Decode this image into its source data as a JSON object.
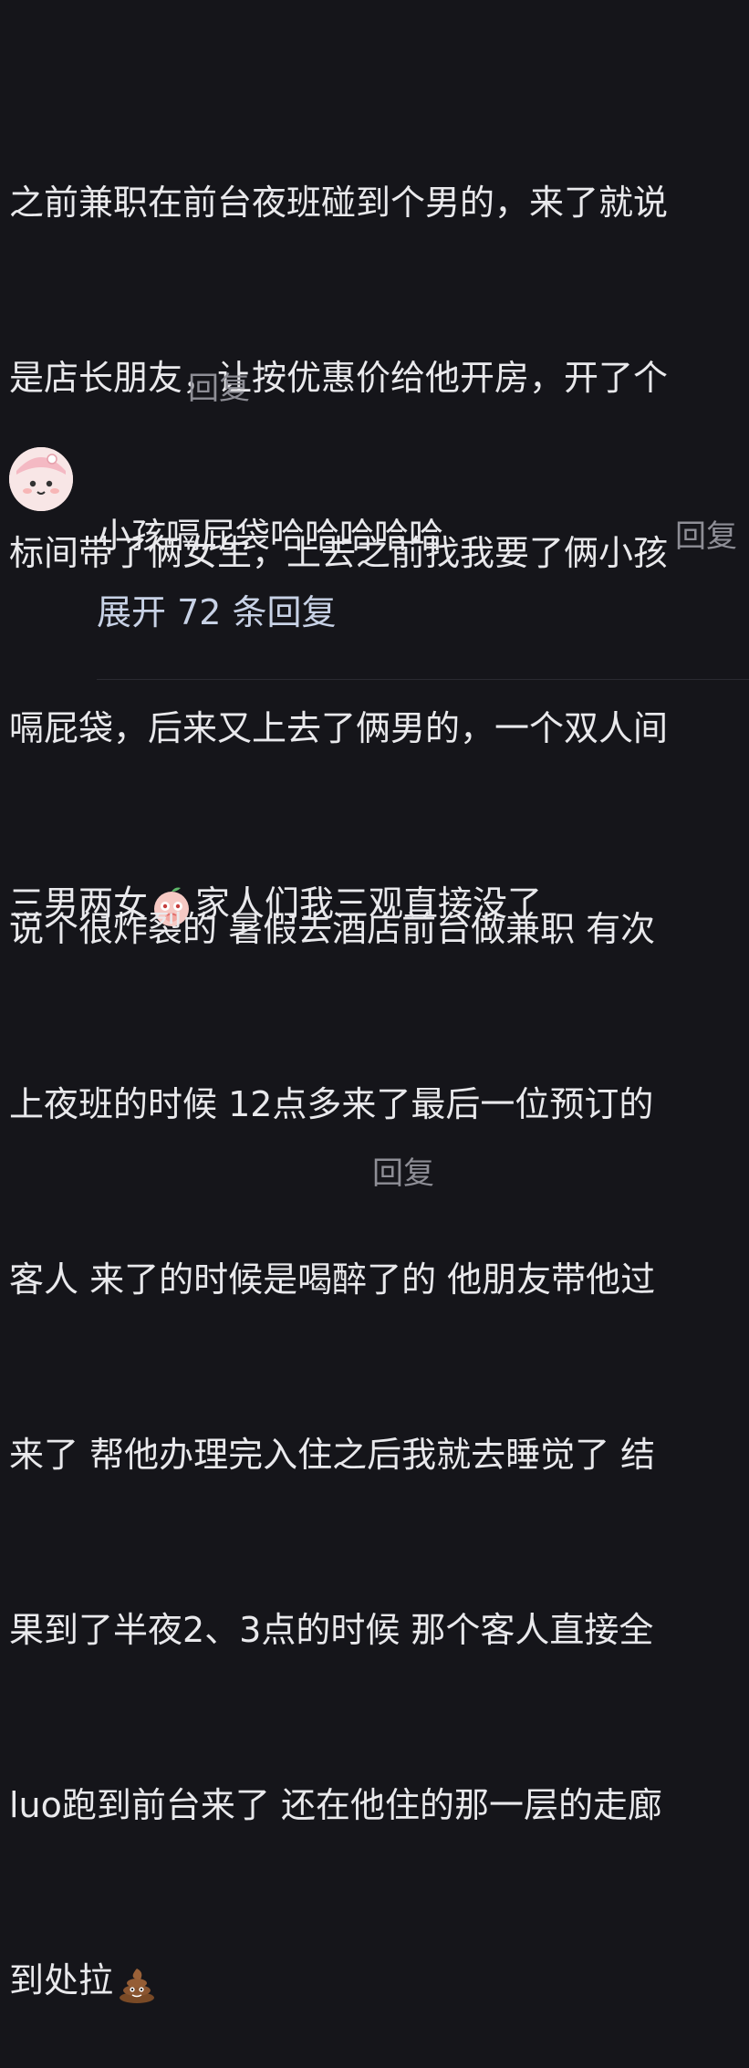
{
  "comments": [
    {
      "lines": [
        "之前兼职在前台夜班碰到个男的，来了就说",
        "是店长朋友，让按优惠价给他开房，开了个",
        "标间带了俩女生，上去之前找我要了俩小孩",
        "嗝屁袋，后来又上去了俩男的，一个双人间"
      ],
      "last_line_before_emoji": "三男两女",
      "emoji": "peach-shy-emoji",
      "last_line_after_emoji": "家人们我三观直接没了",
      "reply_label": "回复"
    },
    {
      "lines": [
        "说个很炸裂的 暑假去酒店前台做兼职 有次",
        "上夜班的时候 12点多来了最后一位预订的",
        "客人 来了的时候是喝醉了的 他朋友带他过",
        "来了 帮他办理完入住之后我就去睡觉了 结",
        "果到了半夜2、3点的时候 那个客人直接全",
        "luo跑到前台来了 还在他住的那一层的走廊"
      ],
      "last_line_before_emoji": "到处拉",
      "emoji": "poop-emoji",
      "reply_label": "回复"
    }
  ],
  "sub_reply": {
    "avatar": "cartoon-avatar",
    "text": "小孩嗝屁袋哈哈哈哈哈",
    "reply_label": "回复",
    "expand_label": "展开 72 条回复"
  }
}
